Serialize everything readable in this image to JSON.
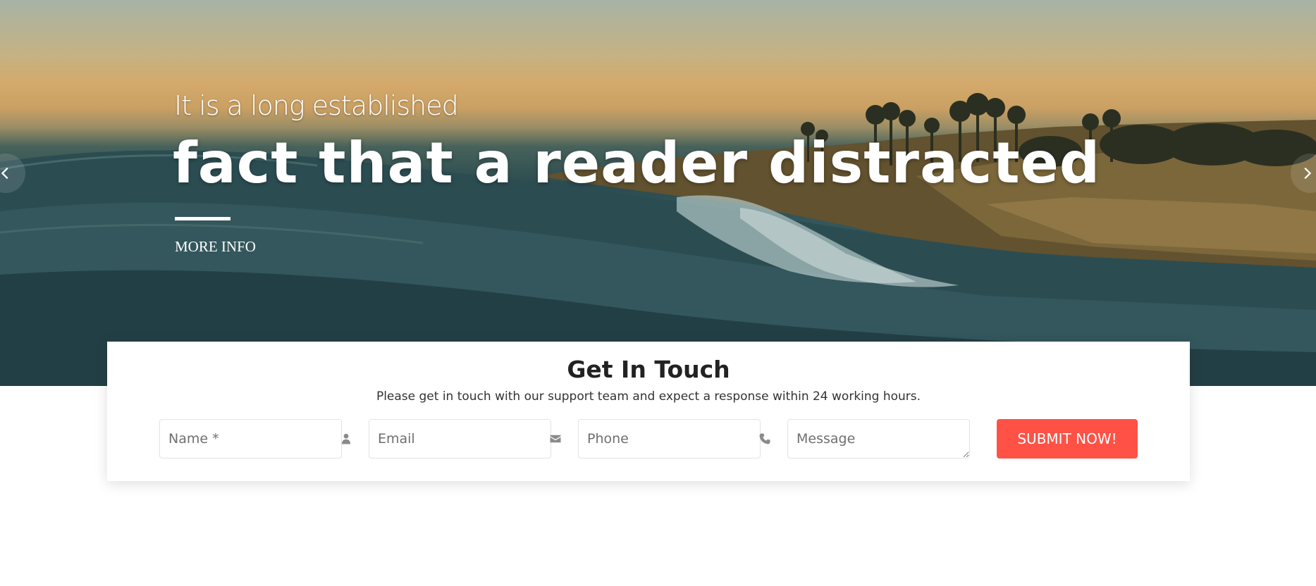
{
  "hero": {
    "subtitle": "It is a long established",
    "title": "fact that a reader distracted",
    "more_info": "MORE INFO"
  },
  "contact": {
    "title": "Get In Touch",
    "description": "Please get in touch with our support team and expect a response within 24 working hours.",
    "fields": {
      "name_placeholder": "Name *",
      "email_placeholder": "Email",
      "phone_placeholder": "Phone",
      "message_placeholder": "Message"
    },
    "submit_label": "SUBMIT NOW!"
  },
  "icons": {
    "prev": "chevron-left-icon",
    "next": "chevron-right-icon",
    "name": "user-icon",
    "email": "envelope-icon",
    "phone": "phone-icon"
  },
  "colors": {
    "accent": "#ff5145",
    "card_bg": "#ffffff",
    "hero_text": "#ffffff"
  }
}
